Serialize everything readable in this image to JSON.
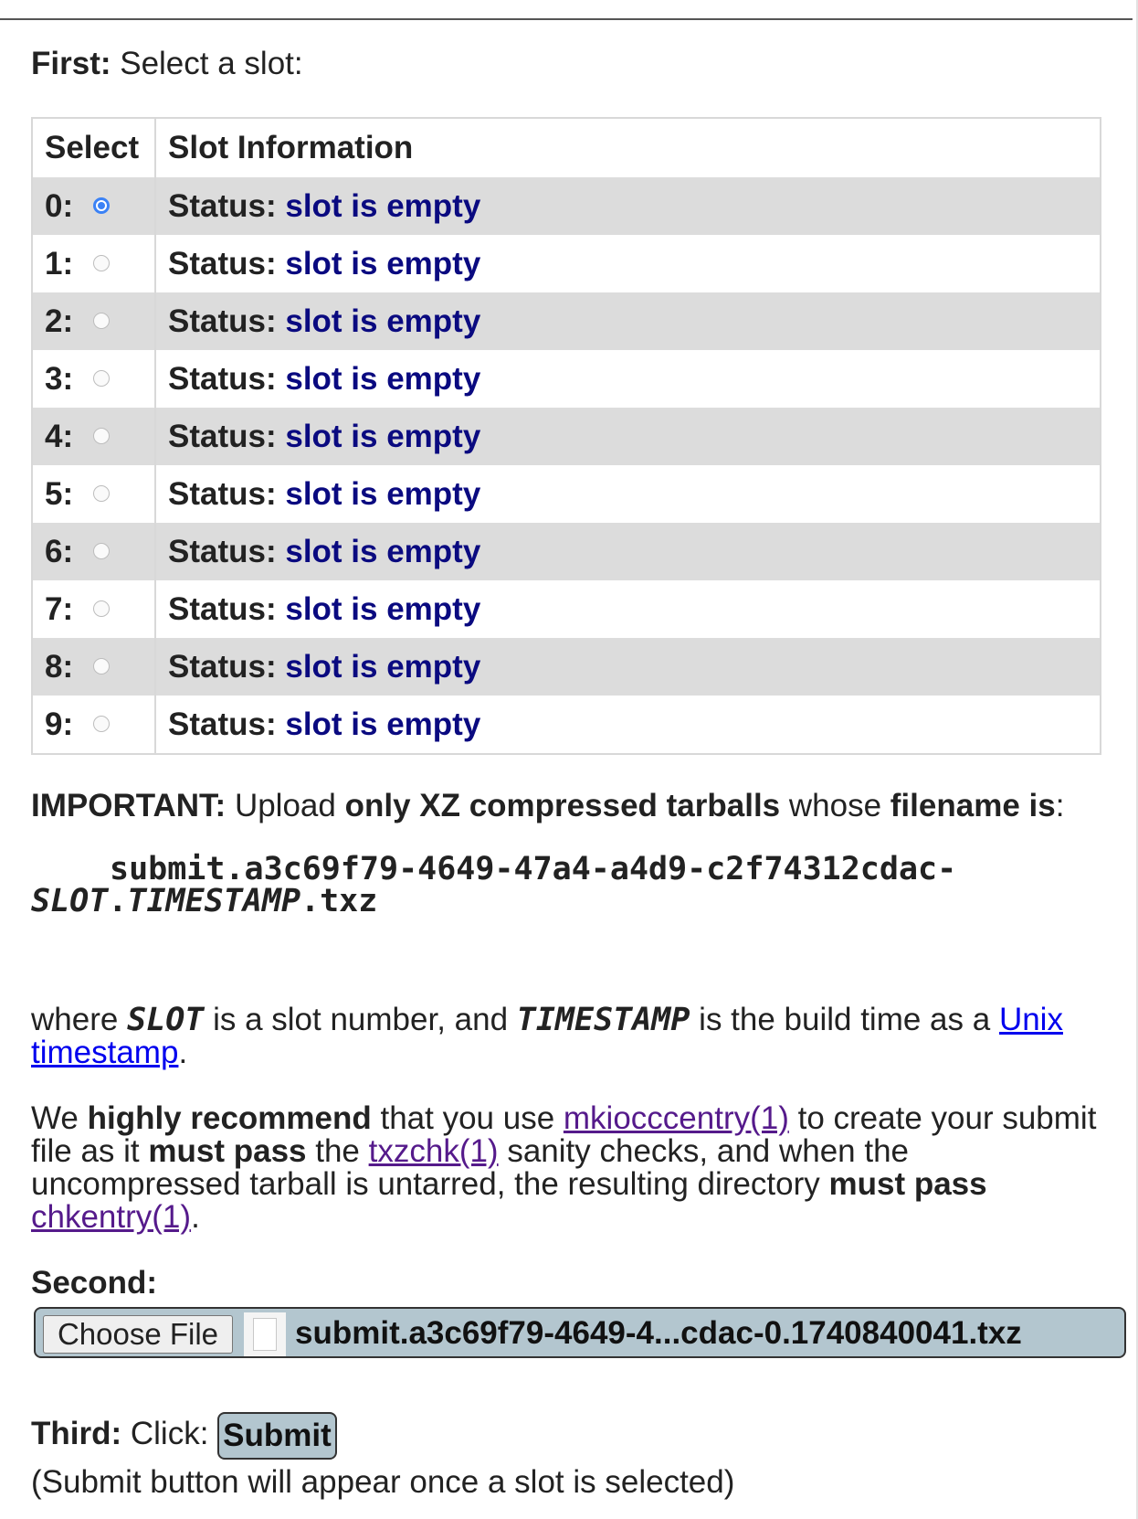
{
  "first": {
    "label": "First:",
    "text": " Select a slot:"
  },
  "table": {
    "headers": [
      "Select",
      "Slot Information"
    ],
    "status_label": "Status:",
    "rows": [
      {
        "slot": "0:",
        "status": "slot is empty",
        "selected": true
      },
      {
        "slot": "1:",
        "status": "slot is empty",
        "selected": false
      },
      {
        "slot": "2:",
        "status": "slot is empty",
        "selected": false
      },
      {
        "slot": "3:",
        "status": "slot is empty",
        "selected": false
      },
      {
        "slot": "4:",
        "status": "slot is empty",
        "selected": false
      },
      {
        "slot": "5:",
        "status": "slot is empty",
        "selected": false
      },
      {
        "slot": "6:",
        "status": "slot is empty",
        "selected": false
      },
      {
        "slot": "7:",
        "status": "slot is empty",
        "selected": false
      },
      {
        "slot": "8:",
        "status": "slot is empty",
        "selected": false
      },
      {
        "slot": "9:",
        "status": "slot is empty",
        "selected": false
      }
    ]
  },
  "important": {
    "label": "IMPORTANT:",
    "t1": " Upload ",
    "b1": "only XZ compressed tarballs",
    "t2": " whose ",
    "b2": "filename is",
    "t3": ":"
  },
  "filename": {
    "line1": "submit.a3c69f79-4649-47a4-a4d9-c2f74312cdac-",
    "slot": "SLOT",
    "dot": ".",
    "timestamp": "TIMESTAMP",
    "ext": ".txz"
  },
  "where": {
    "t1": "where ",
    "slot": "SLOT",
    "t2": " is a slot number, and ",
    "timestamp": "TIMESTAMP",
    "t3": " is the build time as a ",
    "link": "Unix timestamp",
    "t4": "."
  },
  "recommend": {
    "t1": "We ",
    "b1": "highly recommend",
    "t2": " that you use ",
    "link1": "mkiocccentry(1)",
    "t3": " to create your submit file as it ",
    "b2": "must pass",
    "t4": " the ",
    "link2": "txzchk(1)",
    "t5": " sanity checks, and when the uncompressed tarball is untarred, the resulting directory ",
    "b3": "must pass",
    "t6": " ",
    "link3": "chkentry(1)",
    "t7": "."
  },
  "second": {
    "label": "Second:"
  },
  "file_input": {
    "button_label": "Choose File",
    "file_name": "submit.a3c69f79-4649-4...cdac-0.1740840041.txz",
    "icon": "file-icon"
  },
  "third": {
    "label": "Third:",
    "text": " Click: ",
    "submit_label": "Submit"
  },
  "note": "(Submit button will appear once a slot is selected)",
  "colors": {
    "status_value": "#0a0a80",
    "row_alt": "#dcdcdc",
    "file_bar": "#b3c6cf",
    "radio_on": "#3b82f6",
    "link": "#0000ee",
    "link_visited": "#551a8b"
  }
}
